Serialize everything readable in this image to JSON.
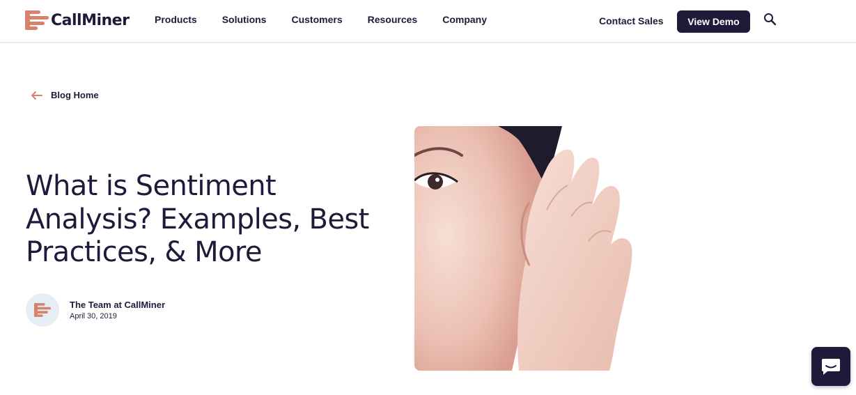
{
  "brand": {
    "name": "CallMiner",
    "accent": "#d8826c",
    "navy": "#1e1b3a"
  },
  "nav": {
    "items": [
      {
        "label": "Products"
      },
      {
        "label": "Solutions"
      },
      {
        "label": "Customers"
      },
      {
        "label": "Resources"
      },
      {
        "label": "Company"
      }
    ],
    "contact_sales": "Contact Sales",
    "view_demo": "View Demo",
    "search_icon": "search-icon"
  },
  "back_link": {
    "label": "Blog Home",
    "icon": "arrow-left-icon"
  },
  "article": {
    "title": "What is Sentiment Analysis? Examples, Best Practices, & More",
    "author": "The Team at CallMiner",
    "date": "April 30, 2019",
    "hero_image": "woman cupping hand behind ear, listening"
  },
  "chat": {
    "icon": "chat-bubble-icon"
  }
}
